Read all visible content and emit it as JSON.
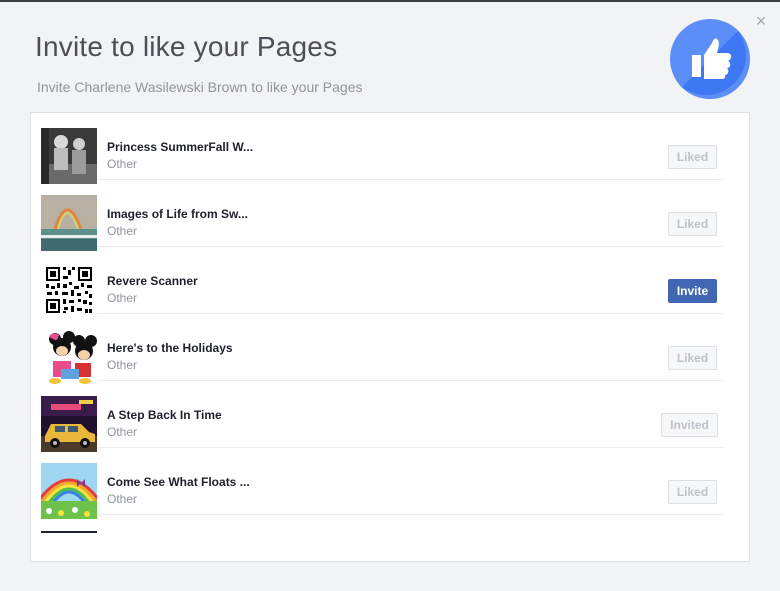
{
  "dialog": {
    "title": "Invite to like your Pages",
    "subtitle": "Invite Charlene Wasilewski Brown to like your Pages",
    "close_label": "×",
    "badge_icon": "thumbs-up-icon",
    "accent_color": "#4267b2"
  },
  "pages": [
    {
      "name": "Princess SummerFall W...",
      "category": "Other",
      "action": "Liked",
      "state": "liked"
    },
    {
      "name": "Images of Life from Sw...",
      "category": "Other",
      "action": "Liked",
      "state": "liked"
    },
    {
      "name": "Revere Scanner",
      "category": "Other",
      "action": "Invite",
      "state": "invite"
    },
    {
      "name": "Here's to the Holidays",
      "category": "Other",
      "action": "Liked",
      "state": "liked"
    },
    {
      "name": "A Step Back In Time",
      "category": "Other",
      "action": "Invited",
      "state": "invited"
    },
    {
      "name": "Come See What Floats ...",
      "category": "Other",
      "action": "Liked",
      "state": "liked"
    }
  ]
}
